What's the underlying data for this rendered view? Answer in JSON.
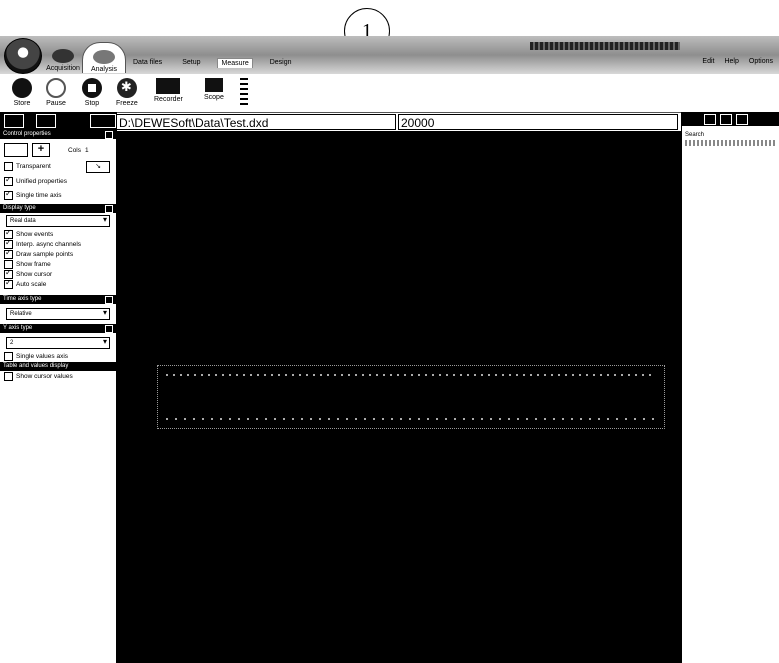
{
  "callout": {
    "number": "1"
  },
  "header": {
    "modes": [
      {
        "label": "Acquisition"
      },
      {
        "label": "Analysis"
      }
    ],
    "tabs": [
      {
        "label": "Data files"
      },
      {
        "label": "Setup"
      },
      {
        "label": "Measure"
      },
      {
        "label": "Design"
      }
    ],
    "right_menu": [
      {
        "label": "Edit"
      },
      {
        "label": "Help"
      },
      {
        "label": "Options"
      }
    ]
  },
  "toolbar": {
    "buttons": [
      {
        "label": "Store",
        "icon": "record-icon"
      },
      {
        "label": "Pause",
        "icon": "pause-icon"
      },
      {
        "label": "Stop",
        "icon": "stop-icon"
      },
      {
        "label": "Freeze",
        "icon": "freeze-icon"
      },
      {
        "label": "Recorder",
        "icon": "recorder-icon"
      },
      {
        "label": "Scope",
        "icon": "scope-icon"
      }
    ]
  },
  "left_panel": {
    "section1": {
      "title": "Control properties",
      "cols_label": "Cols",
      "cols_value": "1",
      "transparent_label": "Transparent",
      "unified_label": "Unified properties",
      "single_time_label": "Single time axis"
    },
    "display_type": {
      "title": "Display type",
      "value": "Real data",
      "options": [
        {
          "label": "Show events",
          "checked": true
        },
        {
          "label": "Interp. async channels",
          "checked": true
        },
        {
          "label": "Draw sample points",
          "checked": true
        },
        {
          "label": "Show frame",
          "checked": false
        },
        {
          "label": "Show cursor",
          "checked": true
        },
        {
          "label": "Auto scale",
          "checked": true
        }
      ]
    },
    "time_axis": {
      "title": "Time axis type",
      "value": "Relative"
    },
    "y_axis": {
      "title": "Y axis type",
      "value": "2",
      "single_values_label": "Single values axis"
    },
    "table": {
      "title": "Table and values display",
      "show_cursor_label": "Show cursor values"
    }
  },
  "fields": {
    "path": "D:\\DEWESoft\\Data\\Test.dxd",
    "count": "20000"
  },
  "right_panel": {
    "label": "Search"
  }
}
